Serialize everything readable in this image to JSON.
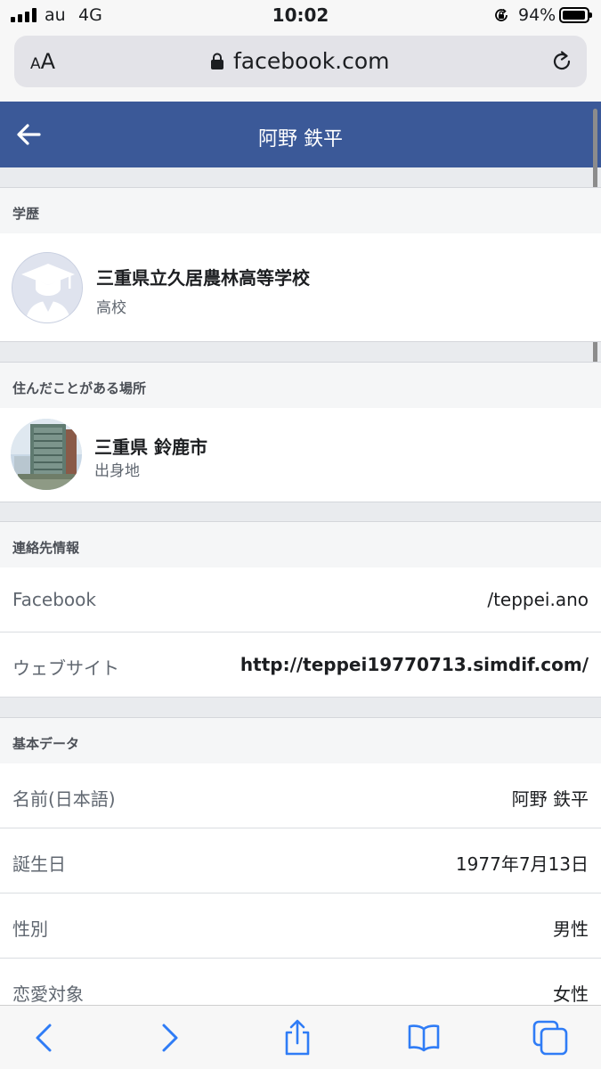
{
  "status_bar": {
    "carrier": "au",
    "network": "4G",
    "time": "10:02",
    "battery": "94%"
  },
  "browser": {
    "text_size_label_small": "A",
    "text_size_label_large": "A",
    "domain": "facebook.com"
  },
  "header": {
    "title": "阿野 鉄平"
  },
  "education": {
    "section_title": "学歴",
    "school_name": "三重県立久居農林高等学校",
    "school_type": "高校"
  },
  "places": {
    "section_title": "住んだことがある場所",
    "place_name": "三重県 鈴鹿市",
    "place_type": "出身地"
  },
  "contact": {
    "section_title": "連絡先情報",
    "rows": [
      {
        "label": "Facebook",
        "value": "/teppei.ano"
      },
      {
        "label": "ウェブサイト",
        "value": "http://teppei19770713.simdif.com/"
      }
    ]
  },
  "basic": {
    "section_title": "基本データ",
    "rows": [
      {
        "label": "名前(日本語)",
        "value": "阿野 鉄平"
      },
      {
        "label": "誕生日",
        "value": "1977年7月13日"
      },
      {
        "label": "性別",
        "value": "男性"
      },
      {
        "label": "恋愛対象",
        "value": "女性"
      }
    ]
  },
  "colors": {
    "facebook_blue": "#3b5998",
    "ios_blue": "#2f7cf6"
  },
  "icons": {
    "back": "arrow-left-icon",
    "lock": "lock-icon",
    "reload": "reload-icon",
    "toolbar": [
      "chevron-left-icon",
      "chevron-right-icon",
      "share-icon",
      "bookmarks-icon",
      "tabs-icon"
    ]
  }
}
